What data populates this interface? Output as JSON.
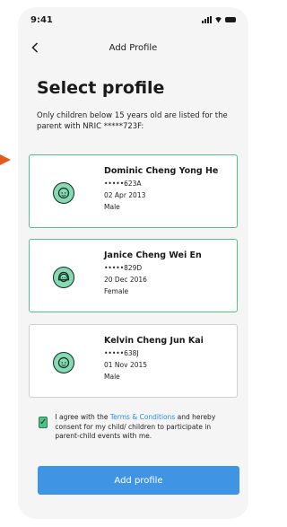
{
  "status_bar": {
    "time": "9:41"
  },
  "header": {
    "title": "Add Profile",
    "back_icon": "chevron-left-icon"
  },
  "main": {
    "title": "Select profile",
    "description": "Only children below 15 years old are listed for the parent with NRIC *****723F:"
  },
  "profiles": [
    {
      "name": "Dominic Cheng Yong He",
      "id": "•••••623A",
      "dob": "02 Apr 2013",
      "gender": "Male"
    },
    {
      "name": "Janice Cheng Wei En",
      "id": "•••••829D",
      "dob": "20 Dec 2016",
      "gender": "Female"
    },
    {
      "name": "Kelvin Cheng Jun Kai",
      "id": "•••••638J",
      "dob": "01 Nov 2015",
      "gender": "Male"
    }
  ],
  "consent": {
    "checked": true,
    "text_before": "I agree with the ",
    "link": "Terms & Conditions",
    "text_after": " and hereby consent for my child/ children to participate in parent-child events with me."
  },
  "actions": {
    "add_label": "Add profile"
  },
  "colors": {
    "accent": "#3f95e4",
    "selected_border": "#54c08a",
    "arrow": "#e35a1a",
    "avatar": "#86d9b0"
  }
}
